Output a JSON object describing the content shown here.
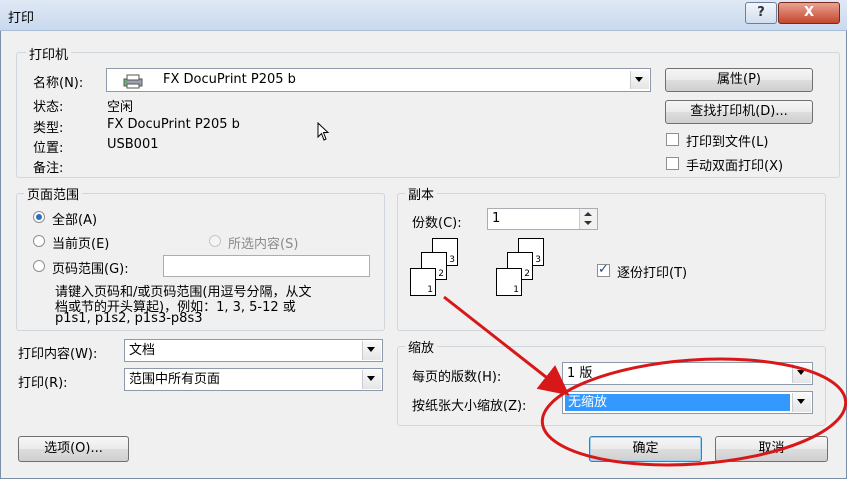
{
  "window": {
    "title": "打印",
    "help": "?",
    "close": "X"
  },
  "printer": {
    "group_title": "打印机",
    "name_label": "名称(N):",
    "name_value": "FX DocuPrint P205 b",
    "status_label": "状态:",
    "status_value": "空闲",
    "type_label": "类型:",
    "type_value": "FX DocuPrint P205 b",
    "location_label": "位置:",
    "location_value": "USB001",
    "comment_label": "备注:",
    "properties_button": "属性(P)",
    "find_printer_button": "查找打印机(D)...",
    "print_to_file": "打印到文件(L)",
    "manual_duplex": "手动双面打印(X)"
  },
  "page_range": {
    "group_title": "页面范围",
    "all": "全部(A)",
    "current_page": "当前页(E)",
    "selection": "所选内容(S)",
    "pages": "页码范围(G):",
    "pages_value": "",
    "hint_line1": "请键入页码和/或页码范围(用逗号分隔，从文",
    "hint_line2": "档或节的开头算起)，例如：1, 3, 5-12 或",
    "hint_line3": "p1s1, p1s2, p1s3-p8s3"
  },
  "copies": {
    "group_title": "副本",
    "count_label": "份数(C):",
    "count_value": "1",
    "collate_label": "逐份打印(T)",
    "collate_checked": true,
    "page_numbers": [
      "1",
      "2",
      "3"
    ]
  },
  "print_what": {
    "label": "打印内容(W):",
    "value": "文档"
  },
  "print_range": {
    "label": "打印(R):",
    "value": "范围中所有页面"
  },
  "zoom": {
    "group_title": "缩放",
    "pages_per_sheet_label": "每页的版数(H):",
    "pages_per_sheet_value": "1 版",
    "scale_to_paper_label": "按纸张大小缩放(Z):",
    "scale_to_paper_value": "无缩放"
  },
  "buttons": {
    "options": "选项(O)...",
    "ok": "确定",
    "cancel": "取消"
  },
  "annotation": {
    "color": "#d81818"
  }
}
